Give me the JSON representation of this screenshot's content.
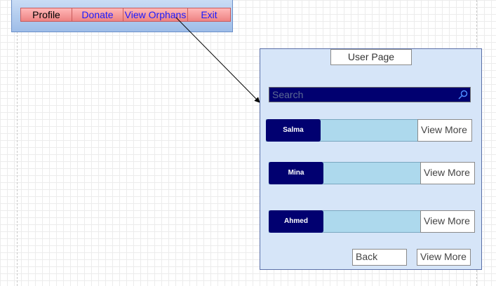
{
  "menu": {
    "items": [
      {
        "label": "Profile"
      },
      {
        "label": "Donate"
      },
      {
        "label": "View Orphans"
      },
      {
        "label": "Exit"
      }
    ]
  },
  "user_page": {
    "title": "User Page",
    "search": {
      "placeholder": "Search"
    },
    "orphans": [
      {
        "name": "Salma",
        "action": "View More"
      },
      {
        "name": "Mina",
        "action": "View More"
      },
      {
        "name": "Ahmed",
        "action": "View More"
      }
    ],
    "back_label": "Back",
    "view_more_label": "View More"
  },
  "colors": {
    "menu_bar": "#ee8383",
    "link_text": "#1a1aff",
    "panel_bg": "#d6e5f8",
    "dark_navy": "#010070",
    "row_bar": "#add9ed"
  }
}
